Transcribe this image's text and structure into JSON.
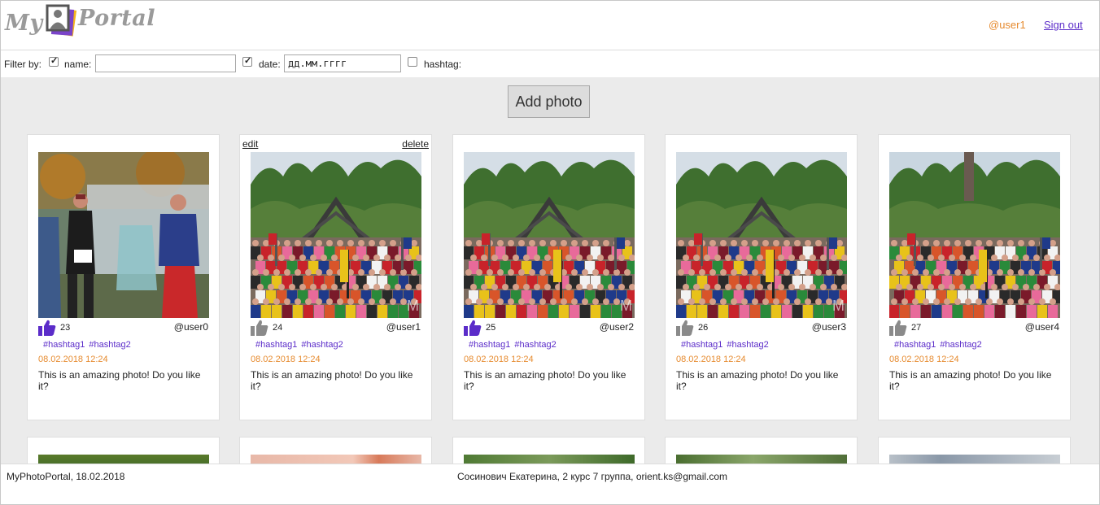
{
  "header": {
    "logo_text_left": "My",
    "logo_text_right": "Portal",
    "user": "@user1",
    "signout": "Sign out",
    "colors": {
      "accent_orange": "#e68a2e",
      "accent_purple": "#5b2cc9"
    }
  },
  "filter": {
    "label": "Filter by:",
    "name_label": "name:",
    "name_checked": true,
    "name_value": "",
    "date_label": "date:",
    "date_checked": true,
    "date_placeholder": "дд.мм.гггг",
    "hashtag_label": "hashtag:",
    "hashtag_checked": false
  },
  "add_photo_label": "Add photo",
  "cards": [
    {
      "likes": "23",
      "author": "@user0",
      "liked": true,
      "editable": false,
      "tags": [
        "#hashtag1",
        "#hashtag2"
      ],
      "date": "08.02.2018 12:24",
      "desc": "This is an amazing photo! Do you like it?",
      "scene": "runner"
    },
    {
      "likes": "24",
      "author": "@user1",
      "liked": false,
      "editable": true,
      "edit_label": "edit",
      "delete_label": "delete",
      "tags": [
        "#hashtag1",
        "#hashtag2"
      ],
      "date": "08.02.2018 12:24",
      "desc": "This is an amazing photo! Do you like it?",
      "scene": "crowd"
    },
    {
      "likes": "25",
      "author": "@user2",
      "liked": true,
      "editable": false,
      "tags": [
        "#hashtag1",
        "#hashtag2"
      ],
      "date": "08.02.2018 12:24",
      "desc": "This is an amazing photo! Do you like it?",
      "scene": "crowd"
    },
    {
      "likes": "26",
      "author": "@user3",
      "liked": false,
      "editable": false,
      "tags": [
        "#hashtag1",
        "#hashtag2"
      ],
      "date": "08.02.2018 12:24",
      "desc": "This is an amazing photo! Do you like it?",
      "scene": "crowd"
    },
    {
      "likes": "27",
      "author": "@user4",
      "liked": false,
      "editable": false,
      "tags": [
        "#hashtag1",
        "#hashtag2"
      ],
      "date": "08.02.2018 12:24",
      "desc": "This is an amazing photo! Do you like it?",
      "scene": "crowd2"
    }
  ],
  "footer": {
    "left": "MyPhotoPortal, 18.02.2018",
    "center": "Сосинович Екатерина, 2 курс 7 группа, orient.ks@gmail.com"
  },
  "icons": [
    "user-photo-logo-icon",
    "thumbs-up-icon"
  ]
}
